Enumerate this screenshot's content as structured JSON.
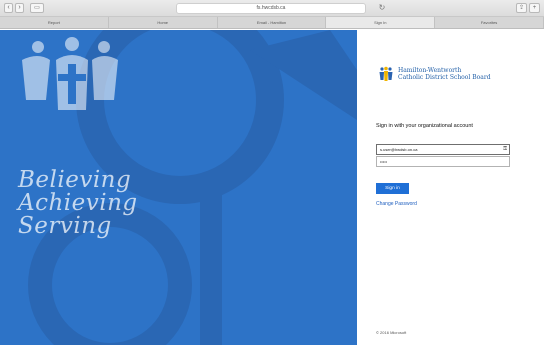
{
  "browser": {
    "address": "fs.hwcdsb.ca",
    "tabs": [
      {
        "label": "Report"
      },
      {
        "label": "Home"
      },
      {
        "label": "Email - Hamilton"
      },
      {
        "label": "Sign In",
        "active": true
      },
      {
        "label": "Favorites"
      }
    ]
  },
  "illustration": {
    "motto": [
      "Believing",
      "Achieving",
      "Serving"
    ],
    "bg_color": "#2d73c7"
  },
  "signin": {
    "board_name_line1": "Hamilton-Wentworth",
    "board_name_line2": "Catholic District School Board",
    "title": "Sign in with your organizational account",
    "email_value": "s.user@hwdsb.on.ca",
    "password_value": "•••••",
    "button_label": "Sign in",
    "change_password": "Change Password",
    "copyright": "© 2016 Microsoft",
    "accent_color": "#1f6fd6"
  }
}
